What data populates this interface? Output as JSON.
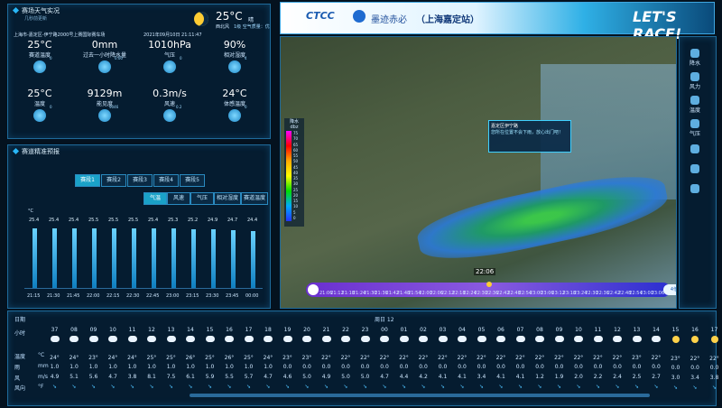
{
  "live": {
    "title": "赛场天气实况",
    "subtitle": "几秒前更新",
    "temp": "25°C",
    "cond": "晴",
    "aqi": "1级 空气质量：优",
    "aqi_label": "西北风",
    "location": "上海市-嘉定区-伊宁路2000号上赛国际赛车场",
    "datetime": "2021年09月10日 21:11:47",
    "row1": [
      {
        "value": "25°C",
        "label": "赛道温度",
        "icon": "track-temp-icon"
      },
      {
        "value": "0mm",
        "label": "过去一小时降水量",
        "icon": "rain-icon"
      },
      {
        "value": "1010hPa",
        "label": "气压",
        "icon": "pressure-icon"
      },
      {
        "value": "90%",
        "label": "相对湿度",
        "icon": "humidity-icon"
      }
    ],
    "row2": [
      {
        "value": "25°C",
        "label": "温度",
        "icon": "thermometer-icon"
      },
      {
        "value": "9129m",
        "label": "能见度",
        "icon": "eye-icon"
      },
      {
        "value": "0.3m/s",
        "label": "风速",
        "icon": "wind-icon"
      },
      {
        "value": "24°C",
        "label": "体感温度",
        "icon": "feels-like-icon"
      }
    ],
    "small_vals": [
      "0",
      "0.00",
      "0",
      "4",
      "0",
      "9046",
      "0.2",
      "0"
    ]
  },
  "forecast": {
    "title": "赛道精准预报",
    "tabs": [
      "赛段1",
      "赛段2",
      "赛段3",
      "赛段4",
      "赛段5"
    ],
    "subtabs": [
      "气温",
      "风速",
      "气压",
      "相对湿度",
      "赛道温度"
    ],
    "unit": "°C",
    "times": [
      "21:15",
      "21:30",
      "21:45",
      "22:00",
      "22:15",
      "22:30",
      "22:45",
      "23:00",
      "23:15",
      "23:30",
      "23:45",
      "00:00"
    ]
  },
  "chart_data": {
    "type": "bar",
    "categories": [
      "21:15",
      "21:30",
      "21:45",
      "22:00",
      "22:15",
      "22:30",
      "22:45",
      "23:00",
      "23:15",
      "23:30",
      "23:45",
      "00:00"
    ],
    "values": [
      25.4,
      25.4,
      25.4,
      25.5,
      25.5,
      25.5,
      25.4,
      25.3,
      25.2,
      24.9,
      24.7,
      24.4
    ],
    "ylabel": "°C",
    "ylim": [
      0,
      27
    ]
  },
  "banner": {
    "logo": "CTCC",
    "brand": "墨迹赤必",
    "station": "（上海嘉定站）",
    "slogan": "LET'S RACE!"
  },
  "map": {
    "legend_title": "降水",
    "legend_unit": "dbz",
    "legend_values": [
      "75",
      "70",
      "65",
      "60",
      "55",
      "50",
      "45",
      "40",
      "35",
      "30",
      "25",
      "20",
      "15",
      "10",
      "5",
      "0"
    ],
    "popup_title": "嘉定区伊宁路",
    "popup_text": "您所在位置不会下雨，放心出门吧！",
    "current_time": "22:06",
    "speed": "4倍"
  },
  "rail": [
    {
      "label": "降水",
      "icon": "rain-icon"
    },
    {
      "label": "风力",
      "icon": "fan-icon"
    },
    {
      "label": "温度",
      "icon": "thermometer-icon"
    },
    {
      "label": "气压",
      "icon": "pressure-icon"
    },
    {
      "label": "",
      "icon": "lightning-icon"
    },
    {
      "label": "",
      "icon": "image-icon"
    },
    {
      "label": "",
      "icon": "globe-icon"
    }
  ],
  "timeline": [
    "21:06",
    "21:12",
    "21:18",
    "21:24",
    "21:30",
    "21:36",
    "21:42",
    "21:48",
    "21:54",
    "22:00",
    "22:06",
    "22:12",
    "22:18",
    "22:24",
    "22:30",
    "22:36",
    "22:42",
    "22:48",
    "22:54",
    "23:00",
    "23:06",
    "23:12",
    "23:18",
    "23:24",
    "22:30",
    "22:36",
    "22:42",
    "22:48",
    "22:54",
    "23:00",
    "23:06"
  ],
  "hourly": {
    "date_label": "日期",
    "day2": "周日 12",
    "hour_label": "小时",
    "temp_label": "温度",
    "temp_unit": "°C",
    "rain_label": "雨",
    "rain_unit": "mm",
    "wind_label": "风",
    "wind_unit": "m/s",
    "winddir_label": "风向",
    "winddir_unit": "°F",
    "hours": [
      "37",
      "08",
      "09",
      "10",
      "11",
      "12",
      "13",
      "14",
      "15",
      "16",
      "17",
      "18",
      "19",
      "20",
      "21",
      "22",
      "23",
      "00",
      "01",
      "02",
      "03",
      "04",
      "05",
      "06",
      "07",
      "08",
      "09",
      "10",
      "11",
      "12",
      "13",
      "14",
      "15",
      "16",
      "17"
    ],
    "temps": [
      "24°",
      "24°",
      "23°",
      "24°",
      "24°",
      "25°",
      "25°",
      "26°",
      "25°",
      "26°",
      "25°",
      "24°",
      "23°",
      "23°",
      "22°",
      "22°",
      "22°",
      "22°",
      "22°",
      "22°",
      "22°",
      "22°",
      "22°",
      "22°",
      "22°",
      "22°",
      "22°",
      "22°",
      "22°",
      "22°",
      "23°",
      "22°",
      "23°",
      "22°",
      "22°"
    ],
    "rain": [
      "1.0",
      "1.0",
      "1.0",
      "1.0",
      "1.0",
      "1.0",
      "1.0",
      "1.0",
      "1.0",
      "1.0",
      "1.0",
      "1.0",
      "0.0",
      "0.0",
      "0.0",
      "0.0",
      "0.0",
      "0.0",
      "0.0",
      "0.0",
      "0.0",
      "0.0",
      "0.0",
      "0.0",
      "0.0",
      "0.0",
      "0.0",
      "0.0",
      "0.0",
      "0.0",
      "0.0",
      "0.0",
      "0.0",
      "0.0",
      "0.0"
    ],
    "wind": [
      "4.9",
      "5.1",
      "5.6",
      "4.7",
      "3.8",
      "8.1",
      "7.5",
      "6.1",
      "5.9",
      "5.5",
      "5.7",
      "4.7",
      "4.6",
      "5.0",
      "4.9",
      "5.0",
      "5.0",
      "4.7",
      "4.4",
      "4.2",
      "4.1",
      "4.1",
      "3.4",
      "4.1",
      "4.1",
      "1.2",
      "1.9",
      "2.0",
      "2.2",
      "2.4",
      "2.5",
      "2.7",
      "3.0",
      "3.4",
      "3.8"
    ]
  }
}
